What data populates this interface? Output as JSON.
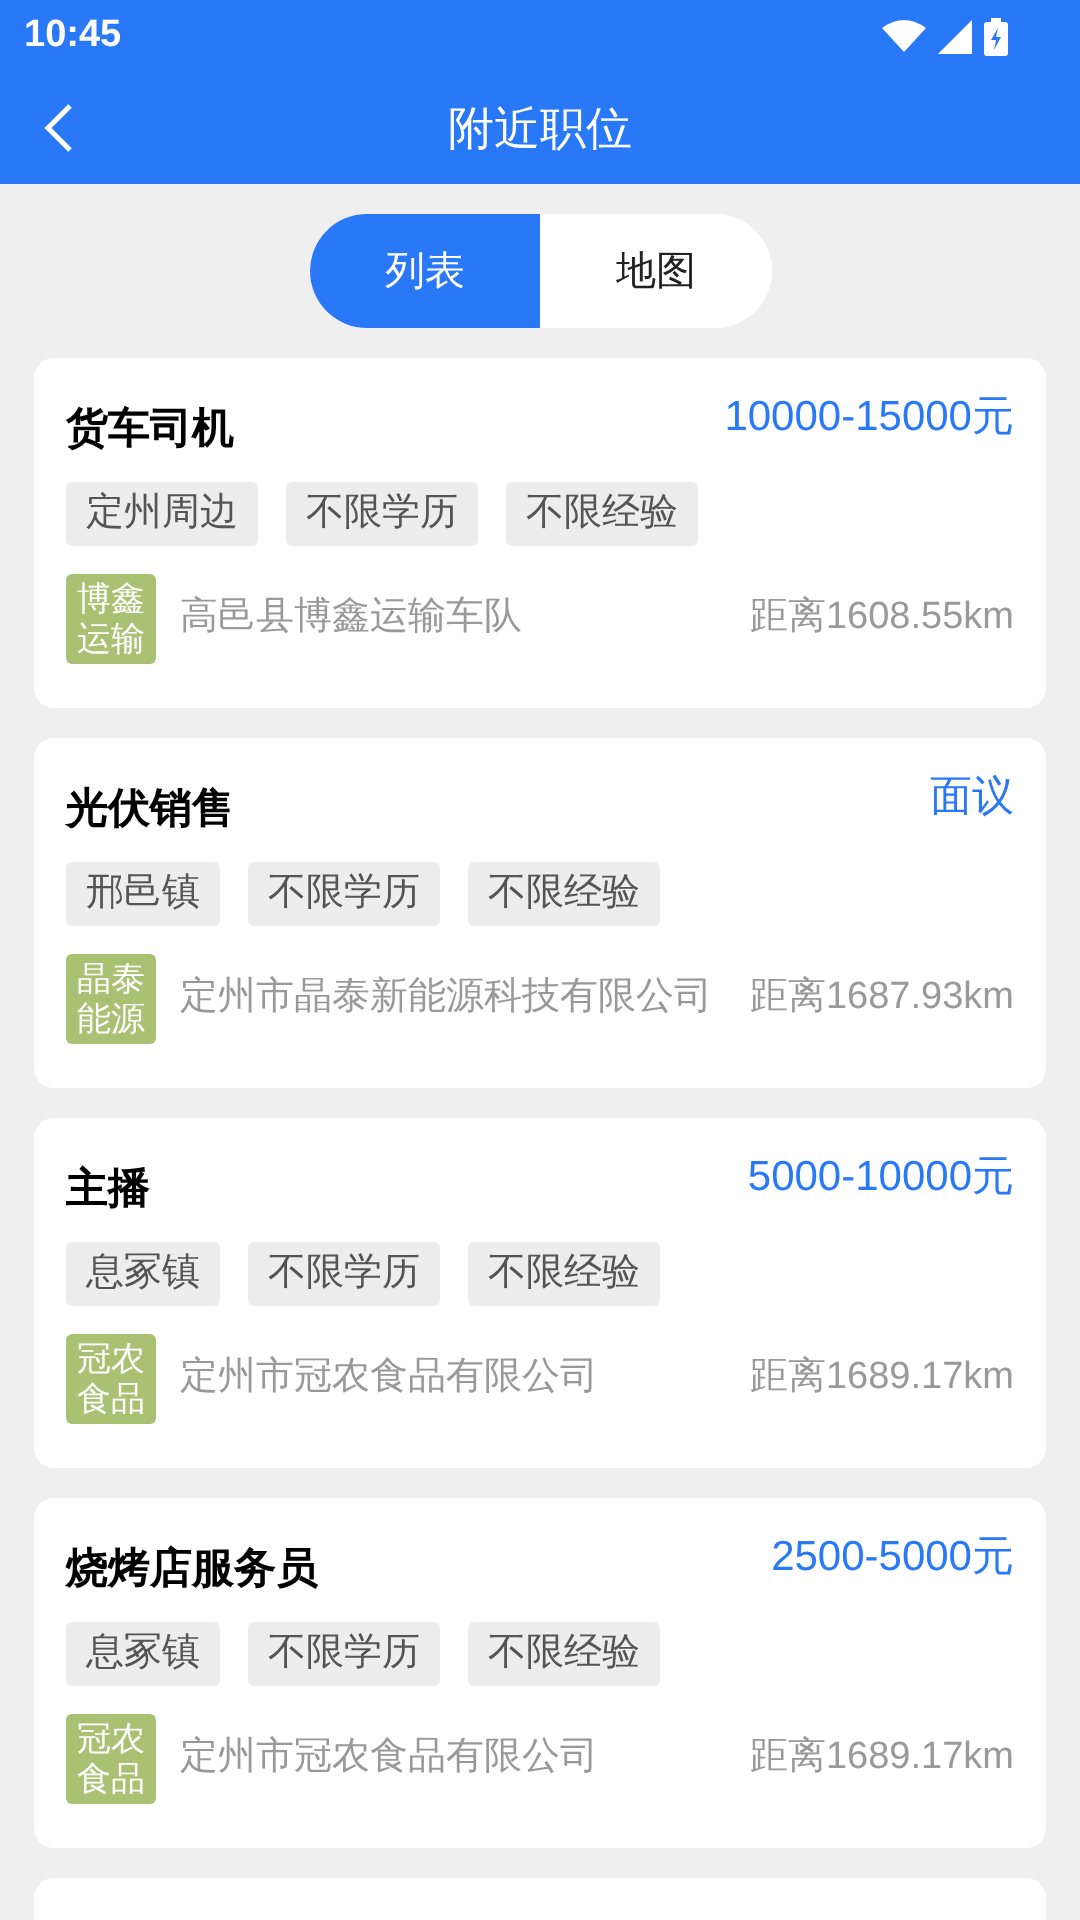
{
  "status_bar": {
    "time": "10:45"
  },
  "header": {
    "title": "附近职位"
  },
  "view_toggle": [
    {
      "label": "列表",
      "selected": true
    },
    {
      "label": "地图",
      "selected": false
    }
  ],
  "jobs": [
    {
      "title": "货车司机",
      "salary": "10000-15000元",
      "tags": [
        "定州周边",
        "不限学历",
        "不限经验"
      ],
      "logo_text": [
        "博",
        "鑫",
        "运",
        "输"
      ],
      "company": "高邑县博鑫运输车队",
      "distance": "距离1608.55km"
    },
    {
      "title": "光伏销售",
      "salary": "面议",
      "tags": [
        "邢邑镇",
        "不限学历",
        "不限经验"
      ],
      "logo_text": [
        "晶",
        "泰",
        "能",
        "源"
      ],
      "company": "定州市晶泰新能源科技有限公司",
      "distance": "距离1687.93km"
    },
    {
      "title": "主播",
      "salary": "5000-10000元",
      "tags": [
        "息冢镇",
        "不限学历",
        "不限经验"
      ],
      "logo_text": [
        "冠",
        "农",
        "食",
        "品"
      ],
      "company": "定州市冠农食品有限公司",
      "distance": "距离1689.17km"
    },
    {
      "title": "烧烤店服务员",
      "salary": "2500-5000元",
      "tags": [
        "息冢镇",
        "不限学历",
        "不限经验"
      ],
      "logo_text": [
        "冠",
        "农",
        "食",
        "品"
      ],
      "company": "定州市冠农食品有限公司",
      "distance": "距离1689.17km"
    }
  ]
}
